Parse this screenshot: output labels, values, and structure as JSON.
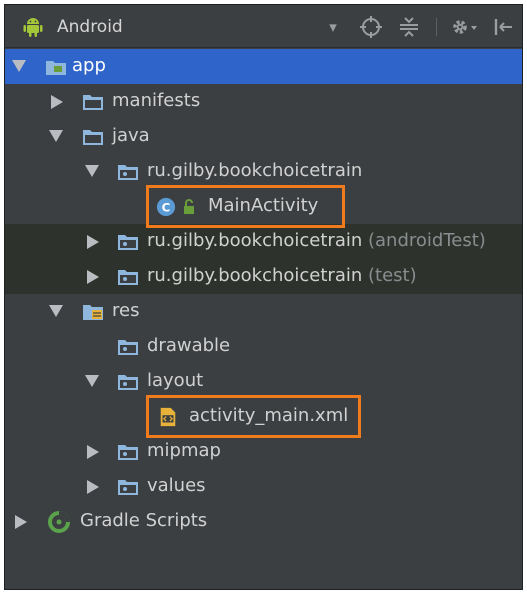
{
  "header": {
    "title": "Android",
    "dropdown_glyph": "▾",
    "icons": [
      "android-icon",
      "crosshair-icon",
      "collapse-all-icon",
      "gear-icon",
      "hide-panel-icon"
    ]
  },
  "tree": {
    "app": "app",
    "manifests": "manifests",
    "java": "java",
    "pkg_main": "ru.gilby.bookchoicetrain",
    "main_activity": "MainActivity",
    "pkg_android_test": "ru.gilby.bookchoicetrain",
    "pkg_android_test_suffix": "(androidTest)",
    "pkg_test": "ru.gilby.bookchoicetrain",
    "pkg_test_suffix": "(test)",
    "res": "res",
    "drawable": "drawable",
    "layout": "layout",
    "activity_main": "activity_main.xml",
    "mipmap": "mipmap",
    "values": "values",
    "gradle": "Gradle Scripts"
  },
  "colors": {
    "panel_bg": "#3c3f41",
    "selection": "#2f65ca",
    "highlight_border": "#f07b1d",
    "text": "#d1d1d1",
    "muted_text": "#8a8d90",
    "android_green": "#a4c639",
    "folder_blue": "#8fb6dc"
  }
}
